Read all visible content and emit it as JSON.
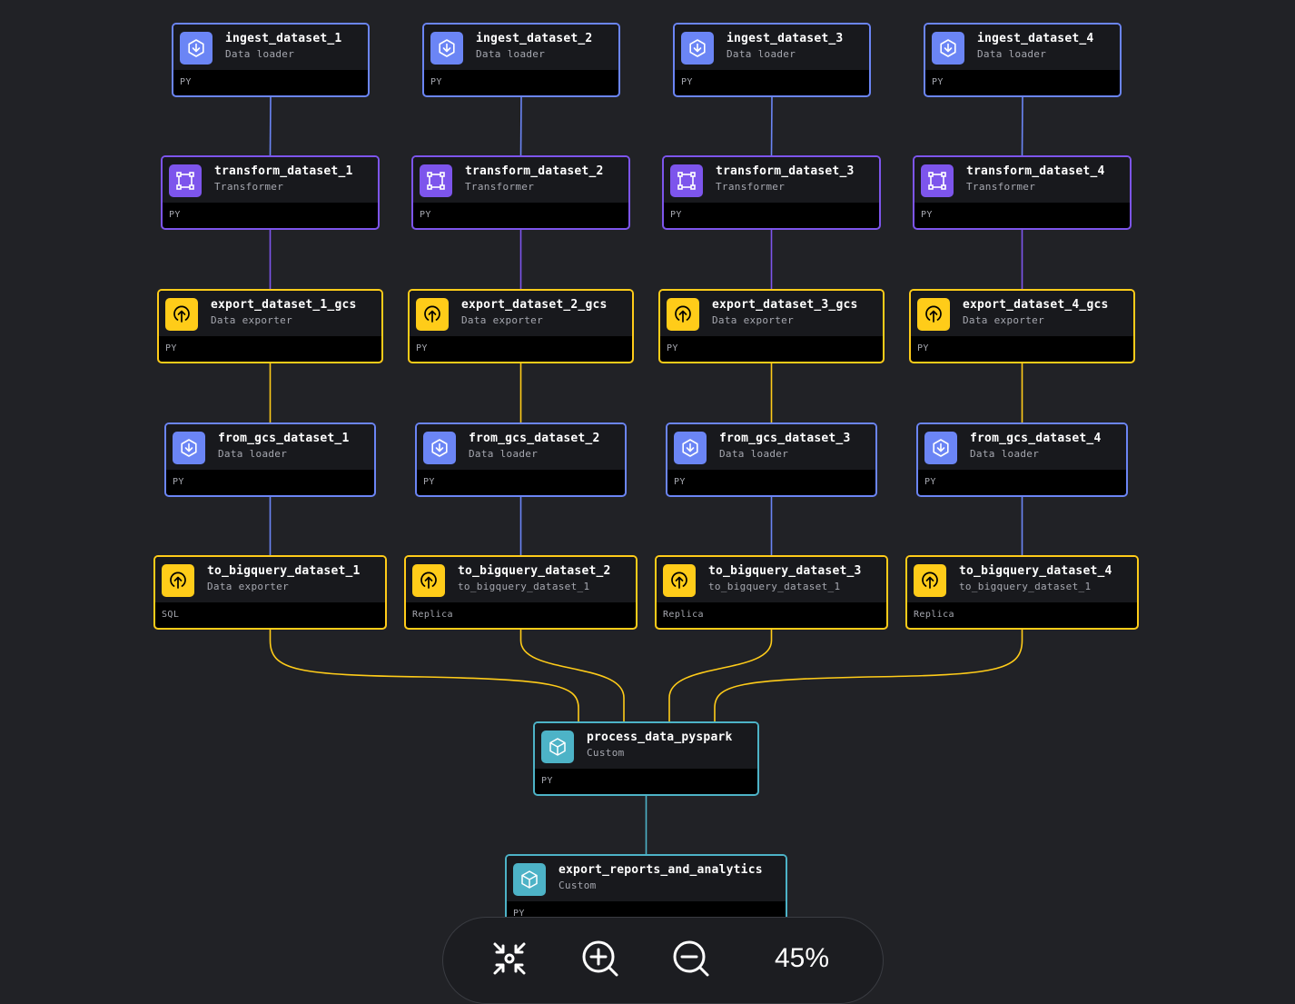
{
  "colors": {
    "background": "#212226",
    "loader": "#6B85F5",
    "transformer": "#7D55EC",
    "exporter": "#FFCC19",
    "custom": "#4DB3C7",
    "text_primary": "#FFFFFF",
    "text_secondary": "#A6A8B0"
  },
  "pipeline": {
    "blocks": [
      {
        "id": "ingest_dataset_1",
        "name": "ingest_dataset_1",
        "subtitle": "Data loader",
        "language": "PY",
        "kind": "loader",
        "icon": "download-icon"
      },
      {
        "id": "ingest_dataset_2",
        "name": "ingest_dataset_2",
        "subtitle": "Data loader",
        "language": "PY",
        "kind": "loader",
        "icon": "download-icon"
      },
      {
        "id": "ingest_dataset_3",
        "name": "ingest_dataset_3",
        "subtitle": "Data loader",
        "language": "PY",
        "kind": "loader",
        "icon": "download-icon"
      },
      {
        "id": "ingest_dataset_4",
        "name": "ingest_dataset_4",
        "subtitle": "Data loader",
        "language": "PY",
        "kind": "loader",
        "icon": "download-icon"
      },
      {
        "id": "transform_dataset_1",
        "name": "transform_dataset_1",
        "subtitle": "Transformer",
        "language": "PY",
        "kind": "transformer",
        "icon": "transform-frame-icon"
      },
      {
        "id": "transform_dataset_2",
        "name": "transform_dataset_2",
        "subtitle": "Transformer",
        "language": "PY",
        "kind": "transformer",
        "icon": "transform-frame-icon"
      },
      {
        "id": "transform_dataset_3",
        "name": "transform_dataset_3",
        "subtitle": "Transformer",
        "language": "PY",
        "kind": "transformer",
        "icon": "transform-frame-icon"
      },
      {
        "id": "transform_dataset_4",
        "name": "transform_dataset_4",
        "subtitle": "Transformer",
        "language": "PY",
        "kind": "transformer",
        "icon": "transform-frame-icon"
      },
      {
        "id": "export_dataset_1_gcs",
        "name": "export_dataset_1_gcs",
        "subtitle": "Data exporter",
        "language": "PY",
        "kind": "exporter",
        "icon": "upload-icon"
      },
      {
        "id": "export_dataset_2_gcs",
        "name": "export_dataset_2_gcs",
        "subtitle": "Data exporter",
        "language": "PY",
        "kind": "exporter",
        "icon": "upload-icon"
      },
      {
        "id": "export_dataset_3_gcs",
        "name": "export_dataset_3_gcs",
        "subtitle": "Data exporter",
        "language": "PY",
        "kind": "exporter",
        "icon": "upload-icon"
      },
      {
        "id": "export_dataset_4_gcs",
        "name": "export_dataset_4_gcs",
        "subtitle": "Data exporter",
        "language": "PY",
        "kind": "exporter",
        "icon": "upload-icon"
      },
      {
        "id": "from_gcs_dataset_1",
        "name": "from_gcs_dataset_1",
        "subtitle": "Data loader",
        "language": "PY",
        "kind": "loader",
        "icon": "download-icon"
      },
      {
        "id": "from_gcs_dataset_2",
        "name": "from_gcs_dataset_2",
        "subtitle": "Data loader",
        "language": "PY",
        "kind": "loader",
        "icon": "download-icon"
      },
      {
        "id": "from_gcs_dataset_3",
        "name": "from_gcs_dataset_3",
        "subtitle": "Data loader",
        "language": "PY",
        "kind": "loader",
        "icon": "download-icon"
      },
      {
        "id": "from_gcs_dataset_4",
        "name": "from_gcs_dataset_4",
        "subtitle": "Data loader",
        "language": "PY",
        "kind": "loader",
        "icon": "download-icon"
      },
      {
        "id": "to_bigquery_dataset_1",
        "name": "to_bigquery_dataset_1",
        "subtitle": "Data exporter",
        "language": "SQL",
        "kind": "exporter",
        "icon": "upload-icon"
      },
      {
        "id": "to_bigquery_dataset_2",
        "name": "to_bigquery_dataset_2",
        "subtitle": "to_bigquery_dataset_1",
        "language": "Replica",
        "kind": "exporter",
        "icon": "upload-icon"
      },
      {
        "id": "to_bigquery_dataset_3",
        "name": "to_bigquery_dataset_3",
        "subtitle": "to_bigquery_dataset_1",
        "language": "Replica",
        "kind": "exporter",
        "icon": "upload-icon"
      },
      {
        "id": "to_bigquery_dataset_4",
        "name": "to_bigquery_dataset_4",
        "subtitle": "to_bigquery_dataset_1",
        "language": "Replica",
        "kind": "exporter",
        "icon": "upload-icon"
      },
      {
        "id": "process_data_pyspark",
        "name": "process_data_pyspark",
        "subtitle": "Custom",
        "language": "PY",
        "kind": "custom",
        "icon": "cube-icon"
      },
      {
        "id": "export_reports_and_analytics",
        "name": "export_reports_and_analytics",
        "subtitle": "Custom",
        "language": "PY",
        "kind": "custom",
        "icon": "cube-icon"
      }
    ],
    "edges": [
      [
        "ingest_dataset_1",
        "transform_dataset_1"
      ],
      [
        "ingest_dataset_2",
        "transform_dataset_2"
      ],
      [
        "ingest_dataset_3",
        "transform_dataset_3"
      ],
      [
        "ingest_dataset_4",
        "transform_dataset_4"
      ],
      [
        "transform_dataset_1",
        "export_dataset_1_gcs"
      ],
      [
        "transform_dataset_2",
        "export_dataset_2_gcs"
      ],
      [
        "transform_dataset_3",
        "export_dataset_3_gcs"
      ],
      [
        "transform_dataset_4",
        "export_dataset_4_gcs"
      ],
      [
        "export_dataset_1_gcs",
        "from_gcs_dataset_1"
      ],
      [
        "export_dataset_2_gcs",
        "from_gcs_dataset_2"
      ],
      [
        "export_dataset_3_gcs",
        "from_gcs_dataset_3"
      ],
      [
        "export_dataset_4_gcs",
        "from_gcs_dataset_4"
      ],
      [
        "from_gcs_dataset_1",
        "to_bigquery_dataset_1"
      ],
      [
        "from_gcs_dataset_2",
        "to_bigquery_dataset_2"
      ],
      [
        "from_gcs_dataset_3",
        "to_bigquery_dataset_3"
      ],
      [
        "from_gcs_dataset_4",
        "to_bigquery_dataset_4"
      ],
      [
        "to_bigquery_dataset_1",
        "process_data_pyspark"
      ],
      [
        "to_bigquery_dataset_2",
        "process_data_pyspark"
      ],
      [
        "to_bigquery_dataset_3",
        "process_data_pyspark"
      ],
      [
        "to_bigquery_dataset_4",
        "process_data_pyspark"
      ],
      [
        "process_data_pyspark",
        "export_reports_and_analytics"
      ]
    ]
  },
  "controls": {
    "zoom_level": "45%",
    "buttons": [
      {
        "name": "fit-view-button",
        "icon": "collapse-arrows-icon"
      },
      {
        "name": "zoom-in-button",
        "icon": "zoom-in-icon"
      },
      {
        "name": "zoom-out-button",
        "icon": "zoom-out-icon"
      }
    ]
  }
}
